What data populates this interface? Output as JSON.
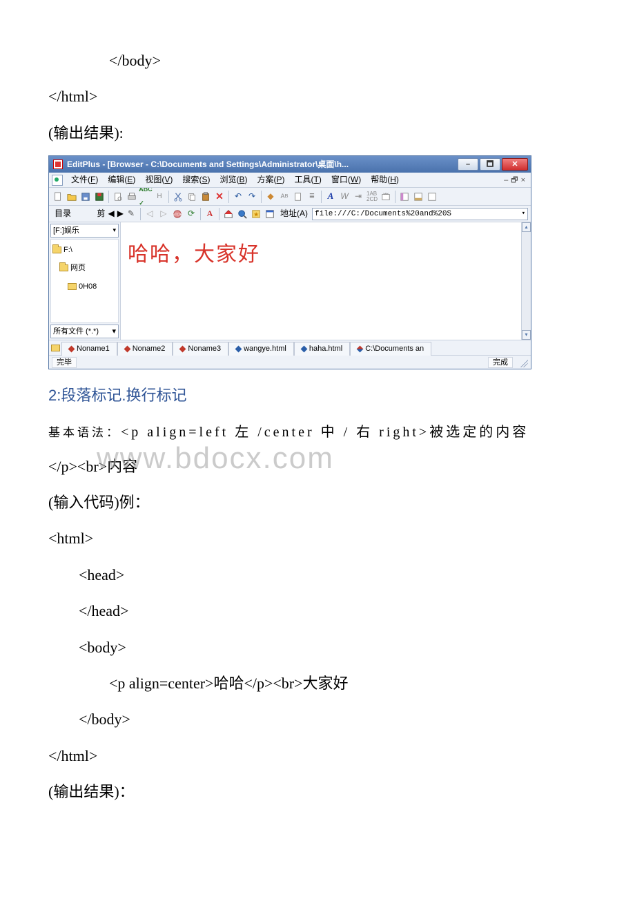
{
  "doc": {
    "code_block_top": [
      "</body>",
      "</html>"
    ],
    "output_label": "(输出结果):",
    "section_heading": "2:段落标记.换行标记",
    "syntax_line_prefix": "基本语法：",
    "syntax_line_main": "<p align=left 左 /center 中 / 右 right>被选定的内容",
    "syntax_line2": "</p><br>内容",
    "input_label": "(输入代码)例：",
    "code_block_bottom": [
      "<html>",
      "<head>",
      "</head>",
      "<body>",
      "<p align=center>哈哈</p><br>大家好",
      "</body>",
      "</html>"
    ],
    "output_label2": "(输出结果)："
  },
  "watermark": "www.bdocx.com",
  "editplus": {
    "title": "EditPlus - [Browser - C:\\Documents and Settings\\Administrator\\桌面\\h...",
    "menus": [
      {
        "label": "文件",
        "key": "F"
      },
      {
        "label": "编辑",
        "key": "E"
      },
      {
        "label": "视图",
        "key": "V"
      },
      {
        "label": "搜索",
        "key": "S"
      },
      {
        "label": "浏览",
        "key": "B"
      },
      {
        "label": "方案",
        "key": "P"
      },
      {
        "label": "工具",
        "key": "T"
      },
      {
        "label": "窗口",
        "key": "W"
      },
      {
        "label": "帮助",
        "key": "H"
      }
    ],
    "mdi_buttons": [
      "–",
      "🗗",
      "×"
    ],
    "sidebar": {
      "dir_label": "目录",
      "clip_label": "剪",
      "drive": "[F:]娱乐",
      "tree": [
        {
          "label": "F:\\",
          "level": 1
        },
        {
          "label": "网页",
          "level": 2
        },
        {
          "label": "0H08",
          "level": 3
        }
      ],
      "filter": "所有文件 (*.*)"
    },
    "toolbar2": {
      "addr_label": "地址(A)",
      "addr_value": "file:///C:/Documents%20and%20S"
    },
    "browser_text": "哈哈，大家好",
    "tabs": [
      {
        "label": "Noname1",
        "dia": "red"
      },
      {
        "label": "Noname2",
        "dia": "red"
      },
      {
        "label": "Noname3",
        "dia": "red"
      },
      {
        "label": "wangye.html",
        "dia": "blue"
      },
      {
        "label": "haha.html",
        "dia": "blue"
      },
      {
        "label": "C:\\Documents an",
        "dia": "rb"
      }
    ],
    "status": {
      "left": "完毕",
      "right": "完成"
    }
  }
}
